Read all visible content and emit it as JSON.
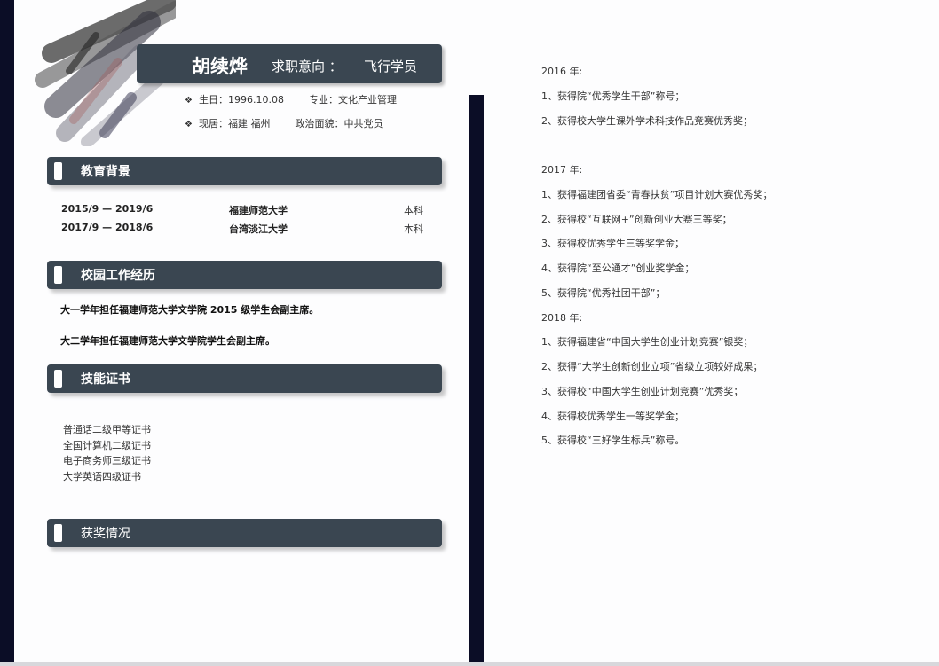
{
  "header": {
    "name": "胡续烨",
    "objective_label": "求职意向 ：",
    "objective_value": "飞行学员",
    "birth": "生日：1996.10.08",
    "major": "专业：文化产业管理",
    "residence": "现居：福建 福州",
    "political": "政治面貌：中共党员"
  },
  "sections": {
    "education": "教育背景",
    "campus": "校园工作经历",
    "skills": "技能证书",
    "awards": "获奖情况"
  },
  "education": [
    {
      "period": "2015/9 — 2019/6",
      "school": "福建师范大学",
      "degree": "本科"
    },
    {
      "period": "2017/9 — 2018/6",
      "school": "台湾淡江大学",
      "degree": "本科"
    }
  ],
  "campus": [
    "大一学年担任福建师范大学文学院 2015 级学生会副主席。",
    "大二学年担任福建师范大学文学院学生会副主席。"
  ],
  "certificates": [
    "普通话二级甲等证书",
    "全国计算机二级证书",
    "电子商务师三级证书",
    "大学英语四级证书"
  ],
  "awards": {
    "y2016": {
      "year": "2016 年:",
      "items": [
        "1、获得院“优秀学生干部”称号；",
        "2、获得校大学生课外学术科技作品竞赛优秀奖；"
      ]
    },
    "y2017": {
      "year": "2017 年:",
      "items": [
        "1、获得福建团省委“青春扶贫”项目计划大赛优秀奖；",
        "2、获得校“互联网+”创新创业大赛三等奖；",
        "3、获得校优秀学生三等奖学金；",
        "4、获得院“至公通才”创业奖学金；",
        "5、获得院“优秀社团干部”；"
      ]
    },
    "y2018": {
      "year": "2018 年:",
      "items": [
        "1、获得福建省“中国大学生创业计划竞赛”银奖；",
        "2、获得“大学生创新创业立项”省级立项较好成果；",
        "3、获得校“中国大学生创业计划竞赛”优秀奖；",
        "4、获得校优秀学生一等奖学金；",
        "5、获得校“三好学生标兵”称号。"
      ]
    }
  }
}
